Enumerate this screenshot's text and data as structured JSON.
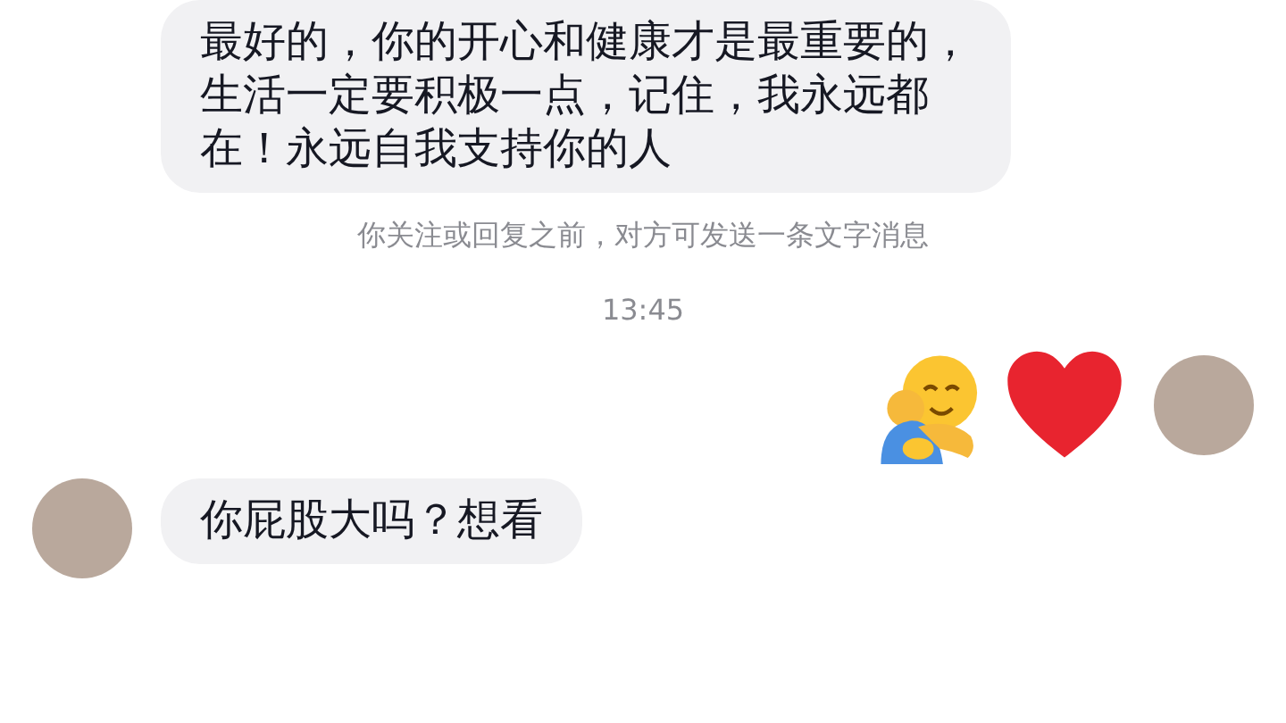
{
  "messages": [
    {
      "kind": "text",
      "outgoing": false,
      "text": "最好的，你的开心和健康才是最重要的，生活一定要积极一点，记住，我永远都在！永远自我支持你的人",
      "avatar": false
    },
    {
      "kind": "notice",
      "text": "你关注或回复之前，对方可发送一条文字消息"
    },
    {
      "kind": "time",
      "text": "13:45"
    },
    {
      "kind": "emoji",
      "outgoing": true,
      "avatar": true
    },
    {
      "kind": "text",
      "outgoing": false,
      "text": "你屁股大吗？想看",
      "avatar": true
    }
  ]
}
